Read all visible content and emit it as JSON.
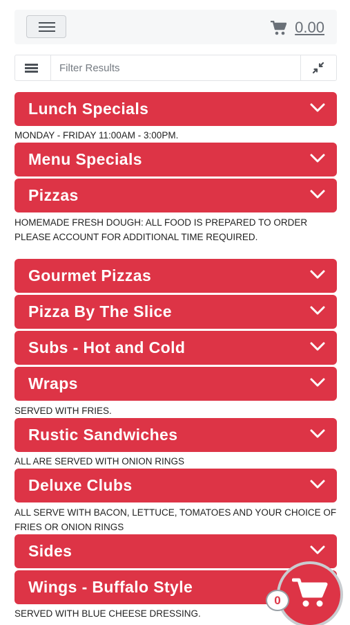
{
  "header": {
    "menu_icon": "hamburger-icon",
    "cart_icon": "shopping-cart-icon",
    "cart_total": "0.00"
  },
  "filter": {
    "placeholder": "Filter Results",
    "list_icon": "list-icon",
    "collapse_icon": "collapse-arrows-icon"
  },
  "categories": [
    {
      "label": "Lunch Specials",
      "note": "MONDAY - FRIDAY 11:00AM - 3:00PM."
    },
    {
      "label": "Menu Specials",
      "note": ""
    },
    {
      "label": "Pizzas",
      "note": "HOMEMADE FRESH DOUGH: ALL FOOD IS PREPARED TO ORDER PLEASE ACCOUNT FOR ADDITIONAL TIME REQUIRED."
    },
    {
      "label": "Gourmet Pizzas",
      "note": ""
    },
    {
      "label": "Pizza By The Slice",
      "note": ""
    },
    {
      "label": "Subs - Hot and Cold",
      "note": ""
    },
    {
      "label": "Wraps",
      "note": "SERVED WITH FRIES."
    },
    {
      "label": "Rustic Sandwiches",
      "note": "ALL ARE SERVED WITH ONION RINGS"
    },
    {
      "label": "Deluxe Clubs",
      "note": "ALL SERVE WITH BACON, LETTUCE, TOMATOES AND YOUR CHOICE OF FRIES OR ONION RINGS"
    },
    {
      "label": "Sides",
      "note": ""
    },
    {
      "label": "Wings - Buffalo Style",
      "note": "SERVED WITH BLUE CHEESE DRESSING."
    }
  ],
  "floating_cart": {
    "icon": "shopping-cart-icon",
    "count": "0"
  },
  "colors": {
    "accent": "#dd3446",
    "header_bg": "#f6f7f8"
  }
}
